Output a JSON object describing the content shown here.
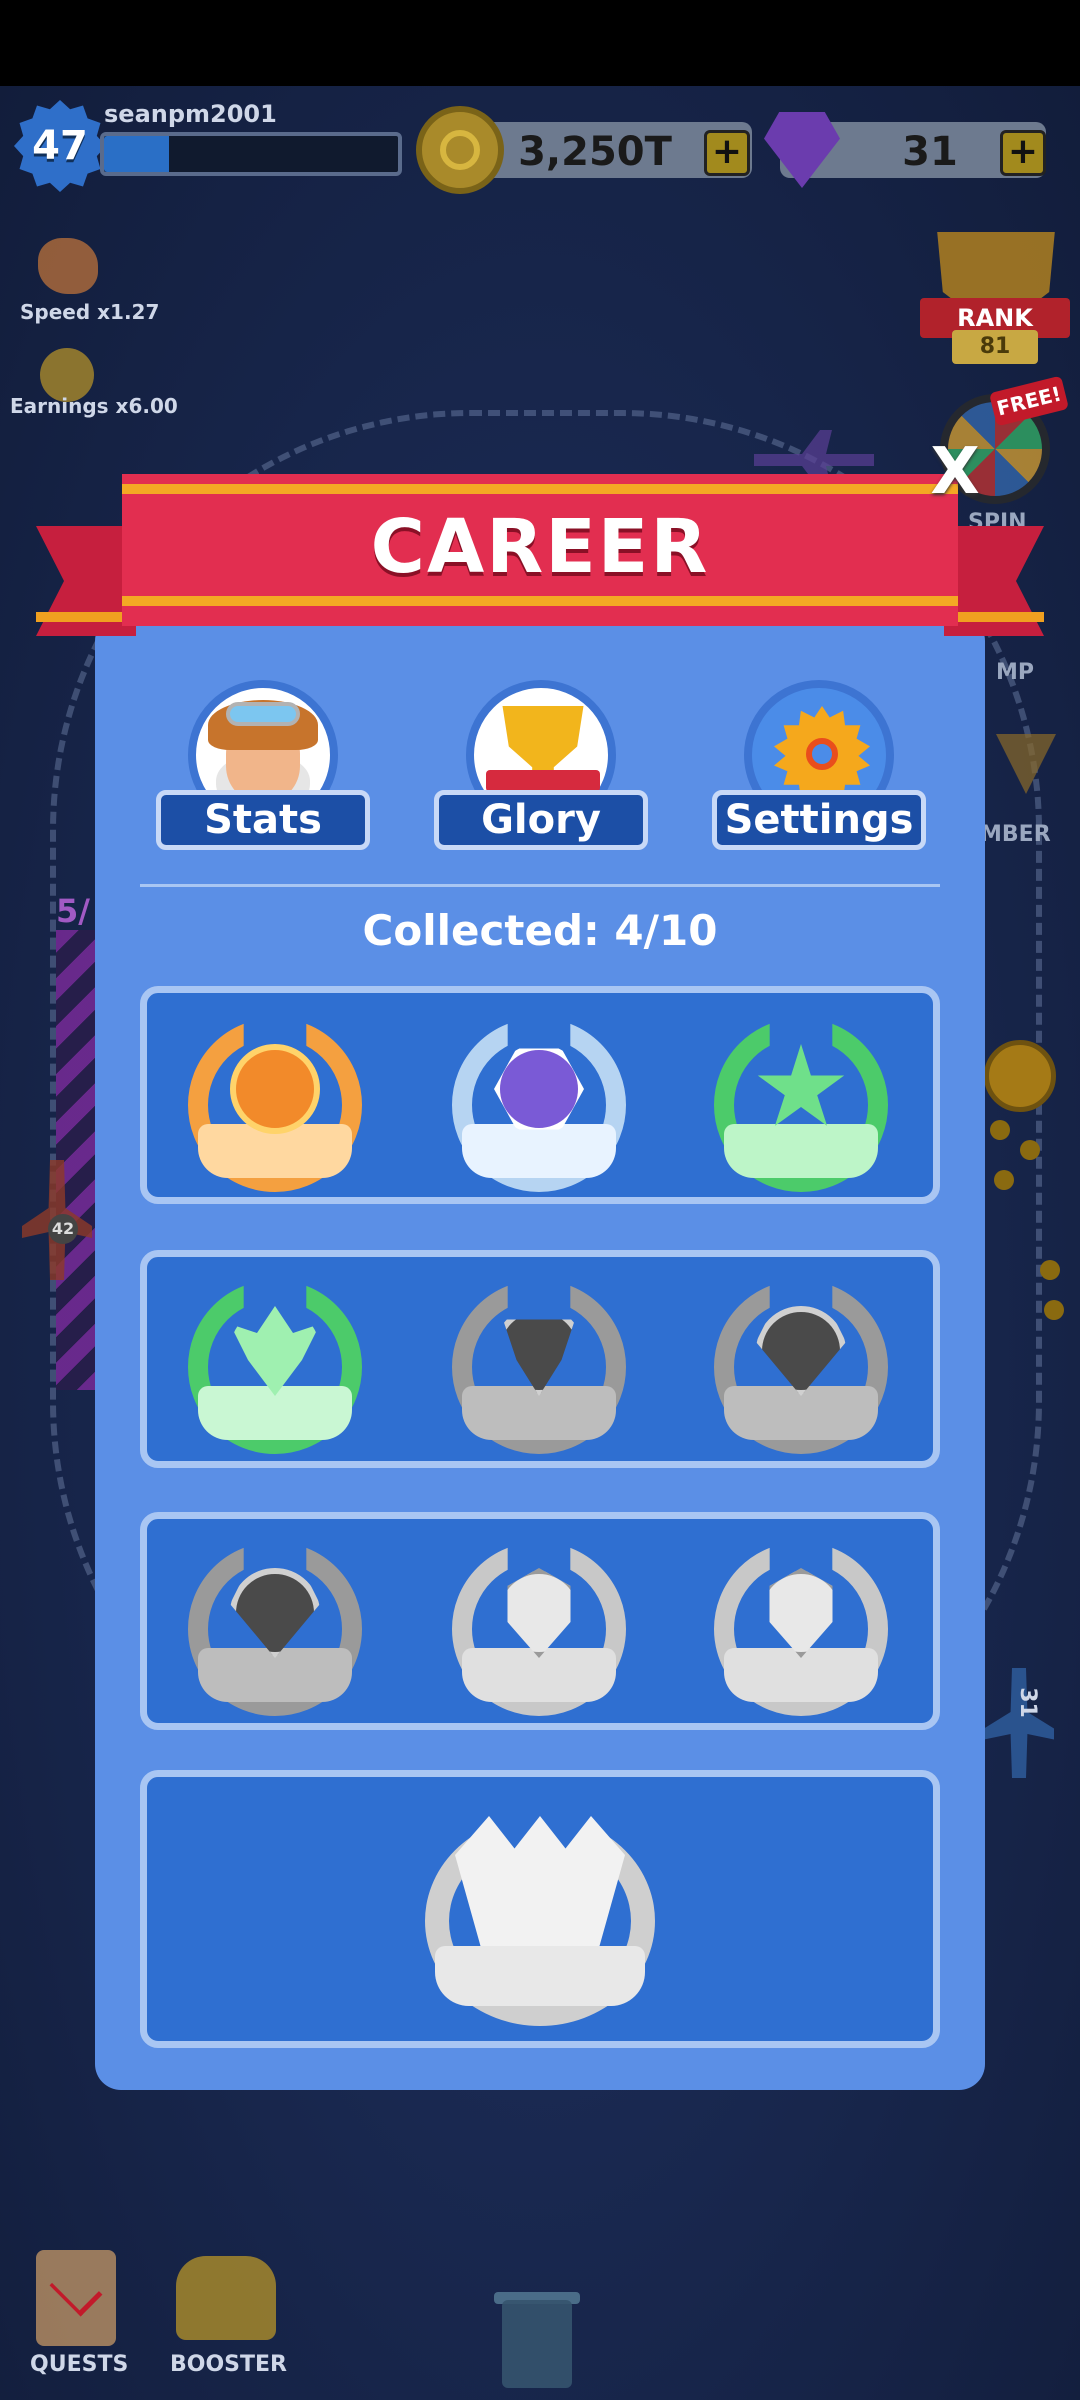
{
  "hud": {
    "level": "47",
    "username": "seanpm2001",
    "xp_progress": 0.22,
    "coins": "3,250T",
    "gems": "31",
    "plus": "+"
  },
  "buffs": {
    "speed": "Speed x1.27",
    "earnings": "Earnings x6.00"
  },
  "side": {
    "rank_label": "RANK",
    "rank_value": "81",
    "free_label": "FREE!",
    "spin_label": "SPIN",
    "partial_1": "MP",
    "partial_2": "MBER",
    "left_partial": "5/",
    "left_plane_num": "42",
    "right_plane_num": "31"
  },
  "modal": {
    "title": "CAREER",
    "close": "X",
    "tabs": [
      {
        "label": "Stats"
      },
      {
        "label": "Glory"
      },
      {
        "label": "Settings"
      }
    ],
    "collected": "Collected: 4/10"
  },
  "bottom": {
    "quests": "QUESTS",
    "booster": "BOOSTER"
  },
  "colors": {
    "banner": "#e22e50",
    "panel": "#5b8fe6",
    "row": "#2f6fd1"
  }
}
